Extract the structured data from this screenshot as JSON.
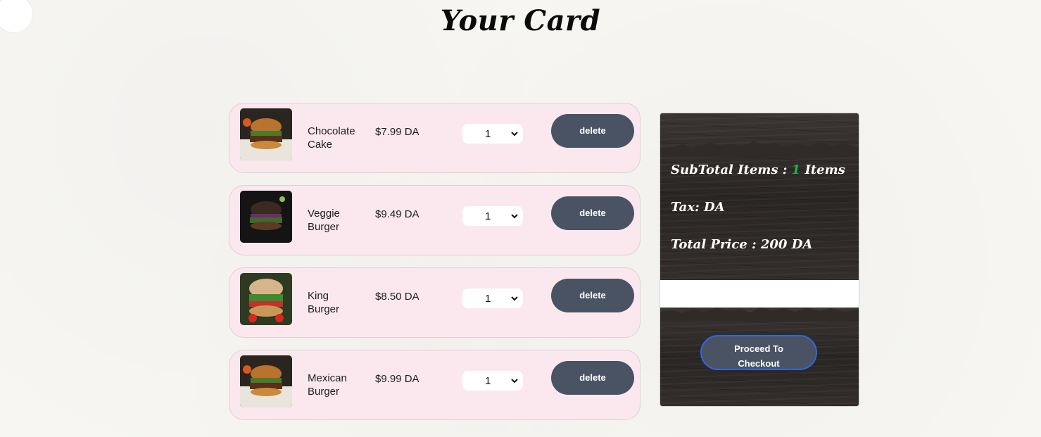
{
  "page": {
    "title": "Your Card"
  },
  "cart": {
    "items": [
      {
        "name_line1": "Chocolate",
        "name_line2": "Cake",
        "price": "$7.99 DA",
        "quantity": "1",
        "delete_label": "delete",
        "image_icon": "burger-photo"
      },
      {
        "name_line1": "Veggie",
        "name_line2": "Burger",
        "price": "$9.49 DA",
        "quantity": "1",
        "delete_label": "delete",
        "image_icon": "burger-photo"
      },
      {
        "name_line1": "King",
        "name_line2": "Burger",
        "price": "$8.50 DA",
        "quantity": "1",
        "delete_label": "delete",
        "image_icon": "burger-photo"
      },
      {
        "name_line1": "Mexican",
        "name_line2": "Burger",
        "price": "$9.99 DA",
        "quantity": "1",
        "delete_label": "delete",
        "image_icon": "burger-photo"
      }
    ]
  },
  "summary": {
    "subtotal_prefix": "SubTotal Items : ",
    "subtotal_count": "1",
    "subtotal_suffix": " Items",
    "tax_label": "Tax: DA",
    "total_label": "Total Price : 200 DA",
    "checkout_line1": "Proceed To",
    "checkout_line2": "Checkout"
  },
  "colors": {
    "item_background": "#fbe8ee",
    "button_background": "#4a5363",
    "count_accent": "#22b14c",
    "checkout_border": "#2f66e0"
  }
}
